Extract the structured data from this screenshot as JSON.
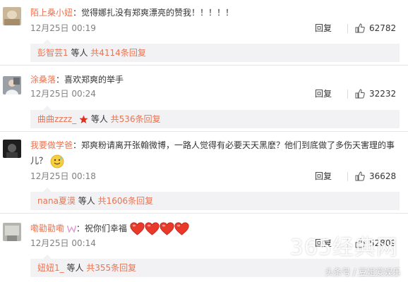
{
  "comments": [
    {
      "user": "陌上桑小妞",
      "separator": "：",
      "text": "觉得娜扎没有郑爽漂亮的赞我！！！！！",
      "date": "12月25日 00:19",
      "reply_label": "回复",
      "likes": "62782",
      "sub_user": "彭智芸1",
      "sub_mid": " 等人 ",
      "sub_more": "共4114条回复"
    },
    {
      "user": "涂桑落",
      "separator": "：",
      "text": "喜欢郑爽的举手",
      "date": "12月25日 00:24",
      "reply_label": "回复",
      "likes": "32232",
      "sub_user": "曲曲zzzz_",
      "sub_mid": " 等人 ",
      "sub_more": "共536条回复"
    },
    {
      "user": "我要做学爸",
      "separator": "：",
      "text": "郑爽粉请离开张翰微博，一路人觉得有必要天天黑麽？他们到底做了多伤天害理的事",
      "text2": "儿？",
      "date": "12月25日 00:18",
      "reply_label": "回复",
      "likes": "36628",
      "sub_user": "nana夏漠",
      "sub_mid": " 等人 ",
      "sub_more": "共1606条回复"
    },
    {
      "user": "嘞勸勸嘞",
      "separator": "：",
      "text": "祝你们幸福",
      "date": "12月25日 00:14",
      "reply_label": "回复",
      "likes": "52809",
      "sub_user": "妞妞1_",
      "sub_mid": " 等人 ",
      "sub_more": "共355条回复"
    }
  ],
  "watermark": "365经典网",
  "credit": "头条号 / 豆姐爱娱乐",
  "colors": {
    "username": "#eb7350",
    "text": "#333333",
    "date": "#808080",
    "sub_bg": "#f2f2f5",
    "heart": "#e8392b"
  },
  "icons": {
    "like": "thumbs-up-icon",
    "star": "star-icon",
    "emoji": "sweat-smile-emoji-icon",
    "heart": "heart-emoji-icon",
    "badge": "w-member-icon"
  }
}
